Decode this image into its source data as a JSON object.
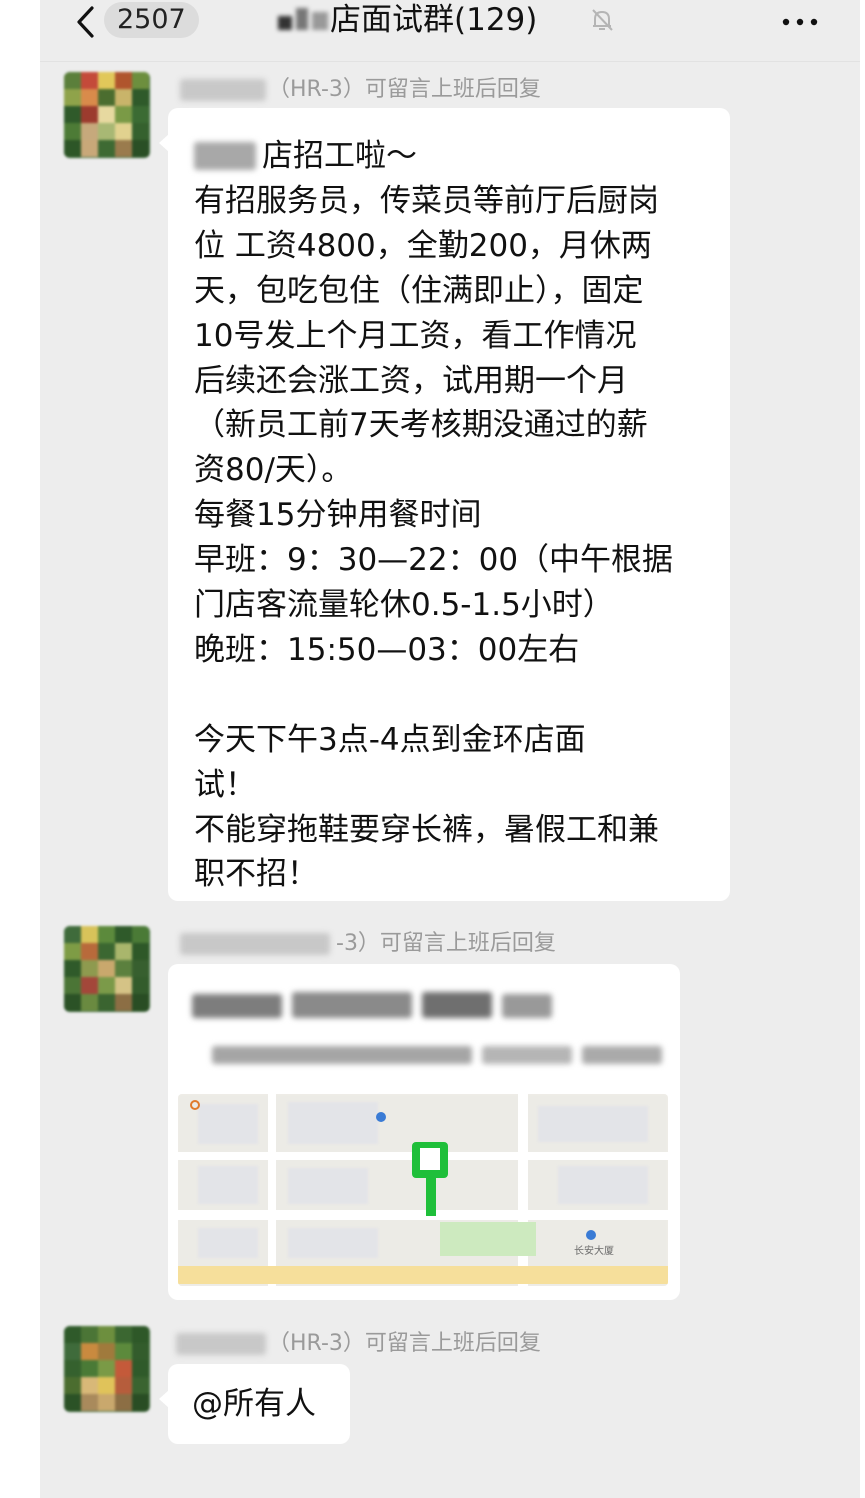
{
  "header": {
    "unread_count": "2507",
    "title": "店面试群(129)",
    "back_icon": "chevron-left-icon",
    "mute_icon": "bell-off-icon",
    "more_icon": "more-dots-icon"
  },
  "messages": [
    {
      "sender_suffix": "（HR-3）可留言上班后回复",
      "lines": [
        "店招工啦～",
        "有招服务员，传菜员等前厅后厨岗",
        "位 工资4800，全勤200，月休两",
        "天，包吃包住（住满即止），固定",
        "10号发上个月工资，看工作情况",
        "后续还会涨工资，试用期一个月",
        "（新员工前7天考核期没通过的薪",
        "资80/天）。",
        "每餐15分钟用餐时间",
        "早班：9：30—22：00（中午根据",
        "门店客流量轮休0.5-1.5小时）",
        "晚班：15:50—03：00左右",
        "",
        "今天下午3点-4点到金环店面",
        "试！",
        "不能穿拖鞋要穿长裤，暑假工和兼",
        "职不招！"
      ]
    },
    {
      "sender_suffix": "-3）可留言上班后回复",
      "type": "location",
      "map_labels": [
        "长安大厦"
      ]
    },
    {
      "sender_suffix": "（HR-3）可留言上班后回复",
      "text": "@所有人"
    }
  ],
  "colors": {
    "background": "#ededed",
    "bubble": "#ffffff",
    "sender_text": "#9a9a9a",
    "pin": "#1fbf3a"
  }
}
